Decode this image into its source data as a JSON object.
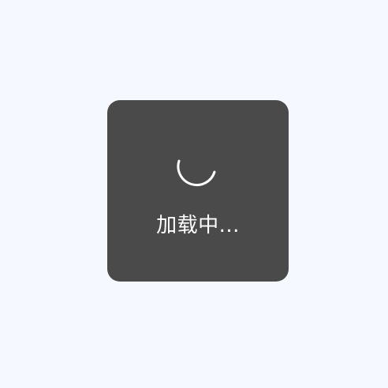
{
  "colors": {
    "page_background": "#f5f9ff",
    "toast_background": "#4a4a4a",
    "toast_text": "#ffffff",
    "spinner_stroke": "#ffffff"
  },
  "loading_toast": {
    "icon": "spinner-icon",
    "text": "加载中..."
  }
}
